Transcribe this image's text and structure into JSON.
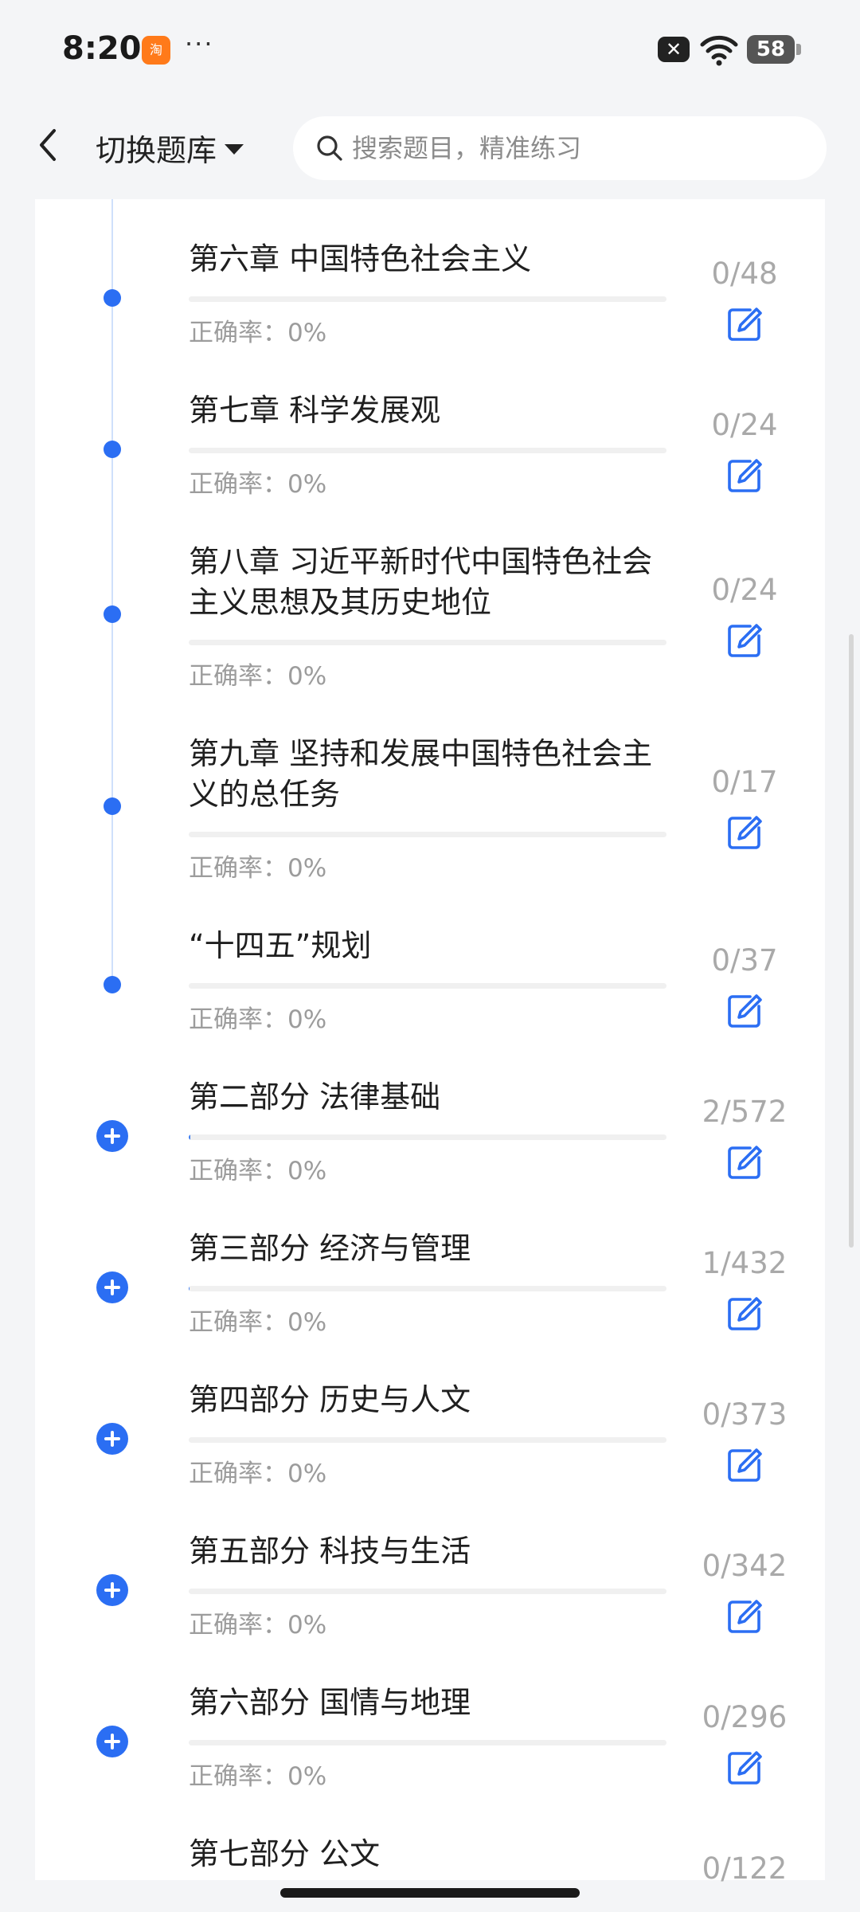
{
  "status_bar": {
    "time": "8:20",
    "app_badge": "淘",
    "more": "···",
    "battery": "58"
  },
  "header": {
    "switch_label": "切换题库",
    "search_placeholder": "搜索题目，精准练习"
  },
  "colors": {
    "accent": "#2b6ef3",
    "timeline": "#cfe0fb",
    "muted_text": "#9c9c9c"
  },
  "items": [
    {
      "title": "第六章 中国特色社会主义",
      "accuracy": "正确率：0%",
      "count": "0/48",
      "progress": 0,
      "marker": "dot"
    },
    {
      "title": "第七章 科学发展观",
      "accuracy": "正确率：0%",
      "count": "0/24",
      "progress": 0,
      "marker": "dot"
    },
    {
      "title": "第八章 习近平新时代中国特色社会主义思想及其历史地位",
      "accuracy": "正确率：0%",
      "count": "0/24",
      "progress": 0,
      "marker": "dot"
    },
    {
      "title": "第九章 坚持和发展中国特色社会主义的总任务",
      "accuracy": "正确率：0%",
      "count": "0/17",
      "progress": 0,
      "marker": "dot"
    },
    {
      "title": "“十四五”规划",
      "accuracy": "正确率：0%",
      "count": "0/37",
      "progress": 0,
      "marker": "dot"
    },
    {
      "title": "第二部分 法律基础",
      "accuracy": "正确率：0%",
      "count": "2/572",
      "progress": 0.0035,
      "marker": "plus"
    },
    {
      "title": "第三部分 经济与管理",
      "accuracy": "正确率：0%",
      "count": "1/432",
      "progress": 0.0023,
      "marker": "plus"
    },
    {
      "title": "第四部分 历史与人文",
      "accuracy": "正确率：0%",
      "count": "0/373",
      "progress": 0,
      "marker": "plus"
    },
    {
      "title": "第五部分 科技与生活",
      "accuracy": "正确率：0%",
      "count": "0/342",
      "progress": 0,
      "marker": "plus"
    },
    {
      "title": "第六部分 国情与地理",
      "accuracy": "正确率：0%",
      "count": "0/296",
      "progress": 0,
      "marker": "plus"
    },
    {
      "title": "第七部分 公文",
      "accuracy": "",
      "count": "0/122",
      "progress": 0,
      "marker": "plus"
    }
  ]
}
